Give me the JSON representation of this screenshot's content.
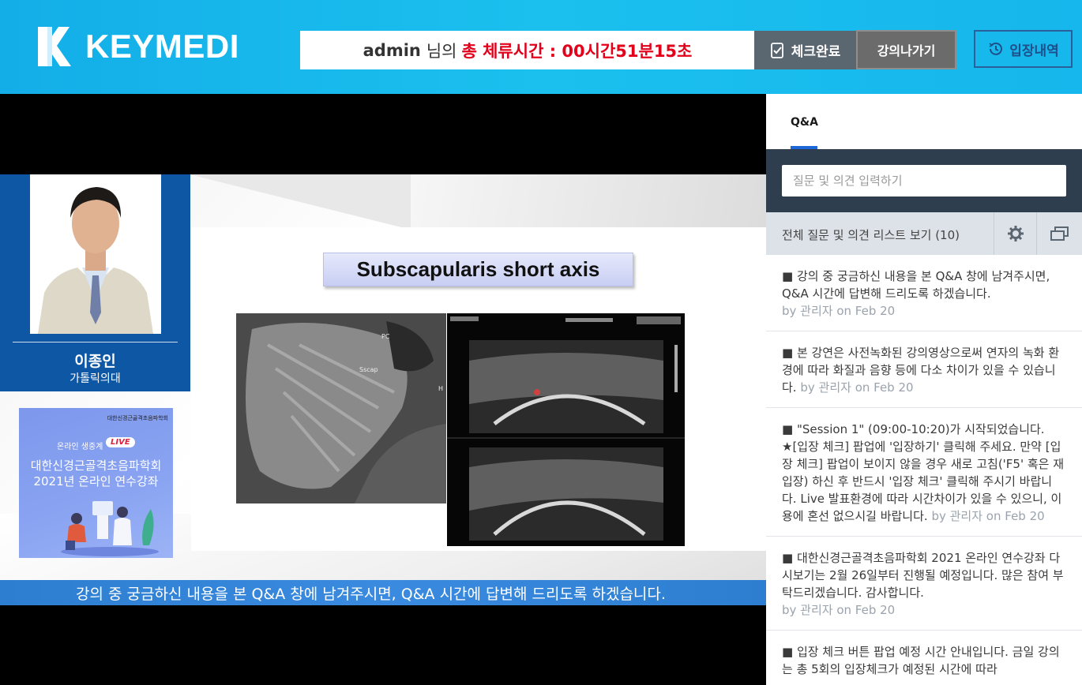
{
  "header": {
    "logo_text": "KEYMEDI",
    "timer_user": "admin",
    "timer_suffix": "님의",
    "timer_label": "총 체류시간 : 00시간51분15초",
    "check_button": "체크완료",
    "exit_button": "강의나가기",
    "history_button": "입장내역"
  },
  "slide": {
    "title": "Subscapularis short axis",
    "speaker_name": "이종인",
    "speaker_org": "가톨릭의대",
    "banner": {
      "org": "대한신경근골격초음파학회",
      "live_label": "온라인 생중계",
      "live_badge": "LIVE",
      "title_line1": "대한신경근골격초음파학회",
      "title_line2": "2021년 온라인 연수강좌"
    },
    "subtitle": "강의 중 궁금하신 내용을 본 Q&A 창에 남겨주시면, Q&A 시간에 답변해 드리도록 하겠습니다."
  },
  "sidebar": {
    "tab_label": "Q&A",
    "input_placeholder": "질문 및 의견 입력하기",
    "list_link": "전체 질문 및 의견 리스트 보기 (10)",
    "posts": [
      {
        "text": "■ 강의 중 궁금하신 내용을 본 Q&A 창에 남겨주시면, Q&A 시간에 답변해 드리도록 하겠습니다.",
        "by": "by 관리자 on Feb 20"
      },
      {
        "text": "■ 본 강연은 사전녹화된 강의영상으로써 연자의 녹화 환경에 따라 화질과 음향 등에 다소 차이가 있을 수 있습니다.",
        "by": "by 관리자 on Feb 20"
      },
      {
        "text": "■ \"Session 1\" (09:00-10:20)가 시작되었습니다. ★[입장 체크] 팝업에 '입장하기' 클릭해 주세요. 만약 [입장 체크] 팝업이 보이지 않을 경우 새로 고침('F5' 혹은 재입장) 하신 후 반드시 '입장 체크' 클릭해 주시기 바랍니다. Live 발표환경에 따라 시간차이가 있을 수 있으니, 이용에 혼선 없으시길 바랍니다.",
        "by": "by 관리자 on Feb 20"
      },
      {
        "text": "■ 대한신경근골격초음파학회 2021 온라인 연수강좌 다시보기는 2월 26일부터 진행될 예정입니다. 많은 참여 부탁드리겠습니다. 감사합니다.",
        "by": "by 관리자 on Feb 20"
      },
      {
        "text": "■ 입장 체크 버튼 팝업 예정 시간 안내입니다. 금일 강의는 총 5회의 입장체크가 예정된 시간에 따라",
        "by": ""
      }
    ]
  },
  "colors": {
    "header_blue": "#1bc0ee",
    "timer_red": "#e2001a",
    "speaker_blue": "#0d57a4",
    "sidebar_dark": "#2f3e4f",
    "tab_accent": "#1e67d8"
  }
}
